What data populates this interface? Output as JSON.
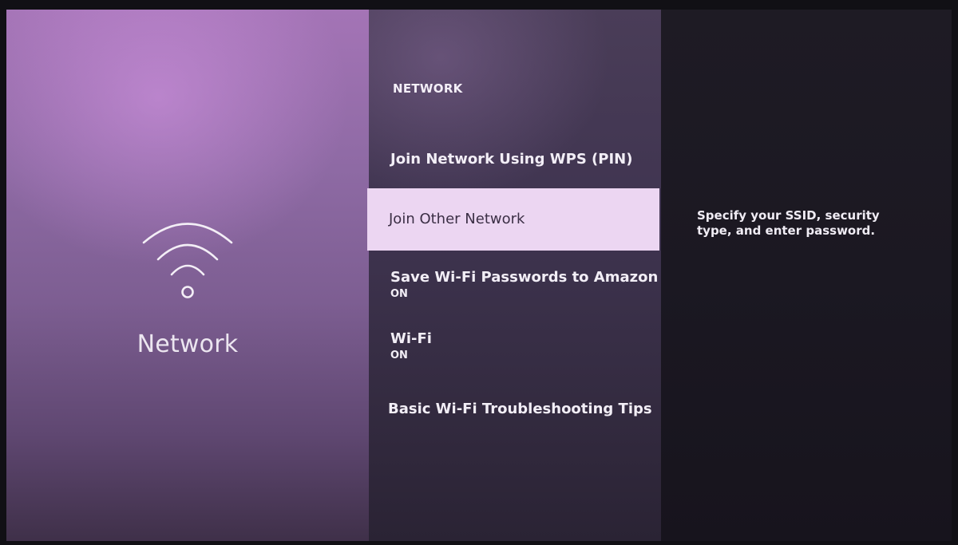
{
  "left_panel": {
    "icon": "wifi-icon",
    "title": "Network"
  },
  "menu": {
    "header": "NETWORK",
    "items": [
      {
        "label": "Join Network Using WPS (PIN)",
        "status": ""
      },
      {
        "label": "Join Other Network",
        "status": "",
        "focused": true
      },
      {
        "label": "Save Wi-Fi Passwords to Amazon",
        "status": "ON"
      },
      {
        "label": "Wi-Fi",
        "status": "ON"
      },
      {
        "label": "Basic Wi-Fi Troubleshooting Tips",
        "status": ""
      }
    ]
  },
  "detail": {
    "description": "Specify your SSID, security type, and enter password."
  },
  "colors": {
    "focus_highlight": "#ecd6f2",
    "text": "#f2eef6",
    "accent_purple": "#a474b6"
  }
}
